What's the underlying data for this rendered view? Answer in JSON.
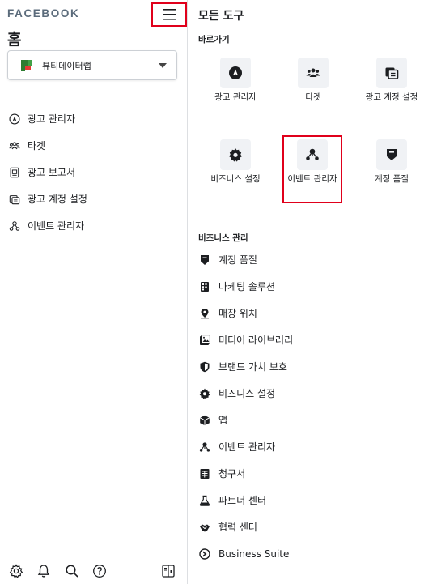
{
  "left": {
    "logo": "FACEBOOK",
    "home_title": "홈",
    "account_name": "뷰티데이터랩",
    "nav": [
      {
        "label": "광고 관리자",
        "icon": "ads-manager-icon"
      },
      {
        "label": "타겟",
        "icon": "audience-icon"
      },
      {
        "label": "광고 보고서",
        "icon": "ads-report-icon"
      },
      {
        "label": "광고 계정 설정",
        "icon": "ad-account-settings-icon"
      },
      {
        "label": "이벤트 관리자",
        "icon": "events-manager-icon"
      }
    ],
    "bottom_icons": [
      "settings-icon",
      "notifications-icon",
      "search-icon",
      "help-icon",
      "panel-toggle-icon"
    ]
  },
  "right": {
    "title": "모든 도구",
    "shortcuts_label": "바로가기",
    "shortcuts": [
      {
        "label": "광고 관리자",
        "icon": "ads-manager-icon"
      },
      {
        "label": "타겟",
        "icon": "audience-icon"
      },
      {
        "label": "광고 계정 설정",
        "icon": "ad-account-settings-icon"
      },
      {
        "label": "비즈니스 설정",
        "icon": "business-settings-icon"
      },
      {
        "label": "이벤트 관리자",
        "icon": "events-manager-icon"
      },
      {
        "label": "계정 품질",
        "icon": "account-quality-icon"
      }
    ],
    "business_label": "비즈니스 관리",
    "business_items": [
      {
        "label": "계정 품질",
        "icon": "account-quality-icon"
      },
      {
        "label": "마케팅 솔루션",
        "icon": "marketing-solutions-icon"
      },
      {
        "label": "매장 위치",
        "icon": "store-location-icon"
      },
      {
        "label": "미디어 라이브러리",
        "icon": "media-library-icon"
      },
      {
        "label": "브랜드 가치 보호",
        "icon": "brand-safety-icon"
      },
      {
        "label": "비즈니스 설정",
        "icon": "business-settings-icon"
      },
      {
        "label": "앱",
        "icon": "apps-icon"
      },
      {
        "label": "이벤트 관리자",
        "icon": "events-manager-icon"
      },
      {
        "label": "청구서",
        "icon": "billing-icon"
      },
      {
        "label": "파트너 센터",
        "icon": "partner-center-icon"
      },
      {
        "label": "협력 센터",
        "icon": "collaboration-center-icon"
      },
      {
        "label": "Business Suite",
        "icon": "business-suite-icon"
      }
    ]
  },
  "colors": {
    "highlight": "#e0001b",
    "icon_dark": "#1c1e21",
    "tile_bg": "#f0f2f5",
    "logo_grey": "#5b6b7b"
  }
}
